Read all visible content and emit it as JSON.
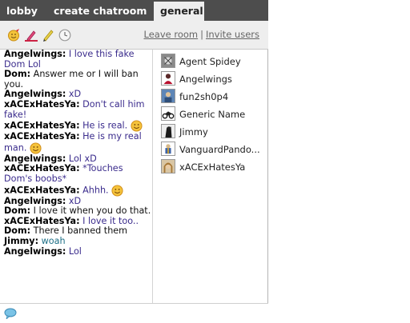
{
  "tabs": [
    {
      "label": "lobby",
      "active": false
    },
    {
      "label": "create chatroom",
      "active": false
    },
    {
      "label": "general",
      "active": true
    }
  ],
  "toolbar": {
    "tools": [
      "smiley-icon",
      "pen-icon",
      "pencil-icon",
      "clock-icon"
    ],
    "leave_label": "Leave room",
    "separator": "|",
    "invite_label": "Invite users"
  },
  "chat": {
    "messages": [
      {
        "nick": "Angelwings:",
        "text": "I love this fake Dom Lol",
        "style": "purple"
      },
      {
        "nick": "Dom:",
        "text": "Answer me or I will ban you.",
        "style": "plain"
      },
      {
        "nick": "Angelwings:",
        "text": "xD",
        "style": "purple"
      },
      {
        "nick": "xACExHatesYa:",
        "text": "Don't call him fake!",
        "style": "purple"
      },
      {
        "nick": "xACExHatesYa:",
        "text": "He is real.",
        "style": "purple",
        "smiley": true
      },
      {
        "nick": "xACExHatesYa:",
        "text": "He is my real man.",
        "style": "purple",
        "smiley": true
      },
      {
        "nick": "Angelwings:",
        "text": "Lol xD",
        "style": "purple"
      },
      {
        "nick": "xACExHatesYa:",
        "text": "*Touches Dom's boobs*",
        "style": "purple"
      },
      {
        "nick": "xACExHatesYa:",
        "text": "Ahhh.",
        "style": "purple",
        "smiley": true
      },
      {
        "nick": "Angelwings:",
        "text": "xD",
        "style": "purple"
      },
      {
        "nick": "Dom:",
        "text": "I love it when you do that.",
        "style": "plain"
      },
      {
        "nick": "xACExHatesYa:",
        "text": "I love it too..",
        "style": "purple"
      },
      {
        "nick": "Dom:",
        "text": "There I banned them",
        "style": "plain"
      },
      {
        "nick": "Jimmy:",
        "text": "woah",
        "style": "teal"
      },
      {
        "nick": "Angelwings:",
        "text": "Lol",
        "style": "purple"
      }
    ]
  },
  "users": [
    {
      "name": "Agent Spidey",
      "avatar": "spider-avatar"
    },
    {
      "name": "Angelwings",
      "avatar": "angel-avatar"
    },
    {
      "name": "fun2sh0p4",
      "avatar": "shopper-avatar"
    },
    {
      "name": "Generic Name",
      "avatar": "motorbike-avatar"
    },
    {
      "name": "Jimmy",
      "avatar": "dark-figure-avatar"
    },
    {
      "name": "VanguardPando...",
      "avatar": "soldier-avatar"
    },
    {
      "name": "xACExHatesYa",
      "avatar": "girl-avatar"
    }
  ],
  "colors": {
    "tabbar": "#4d4d4d",
    "toolbar": "#eeeeee",
    "chat_text": "#3a2b8c",
    "jimmy_text": "#1d6f86"
  }
}
